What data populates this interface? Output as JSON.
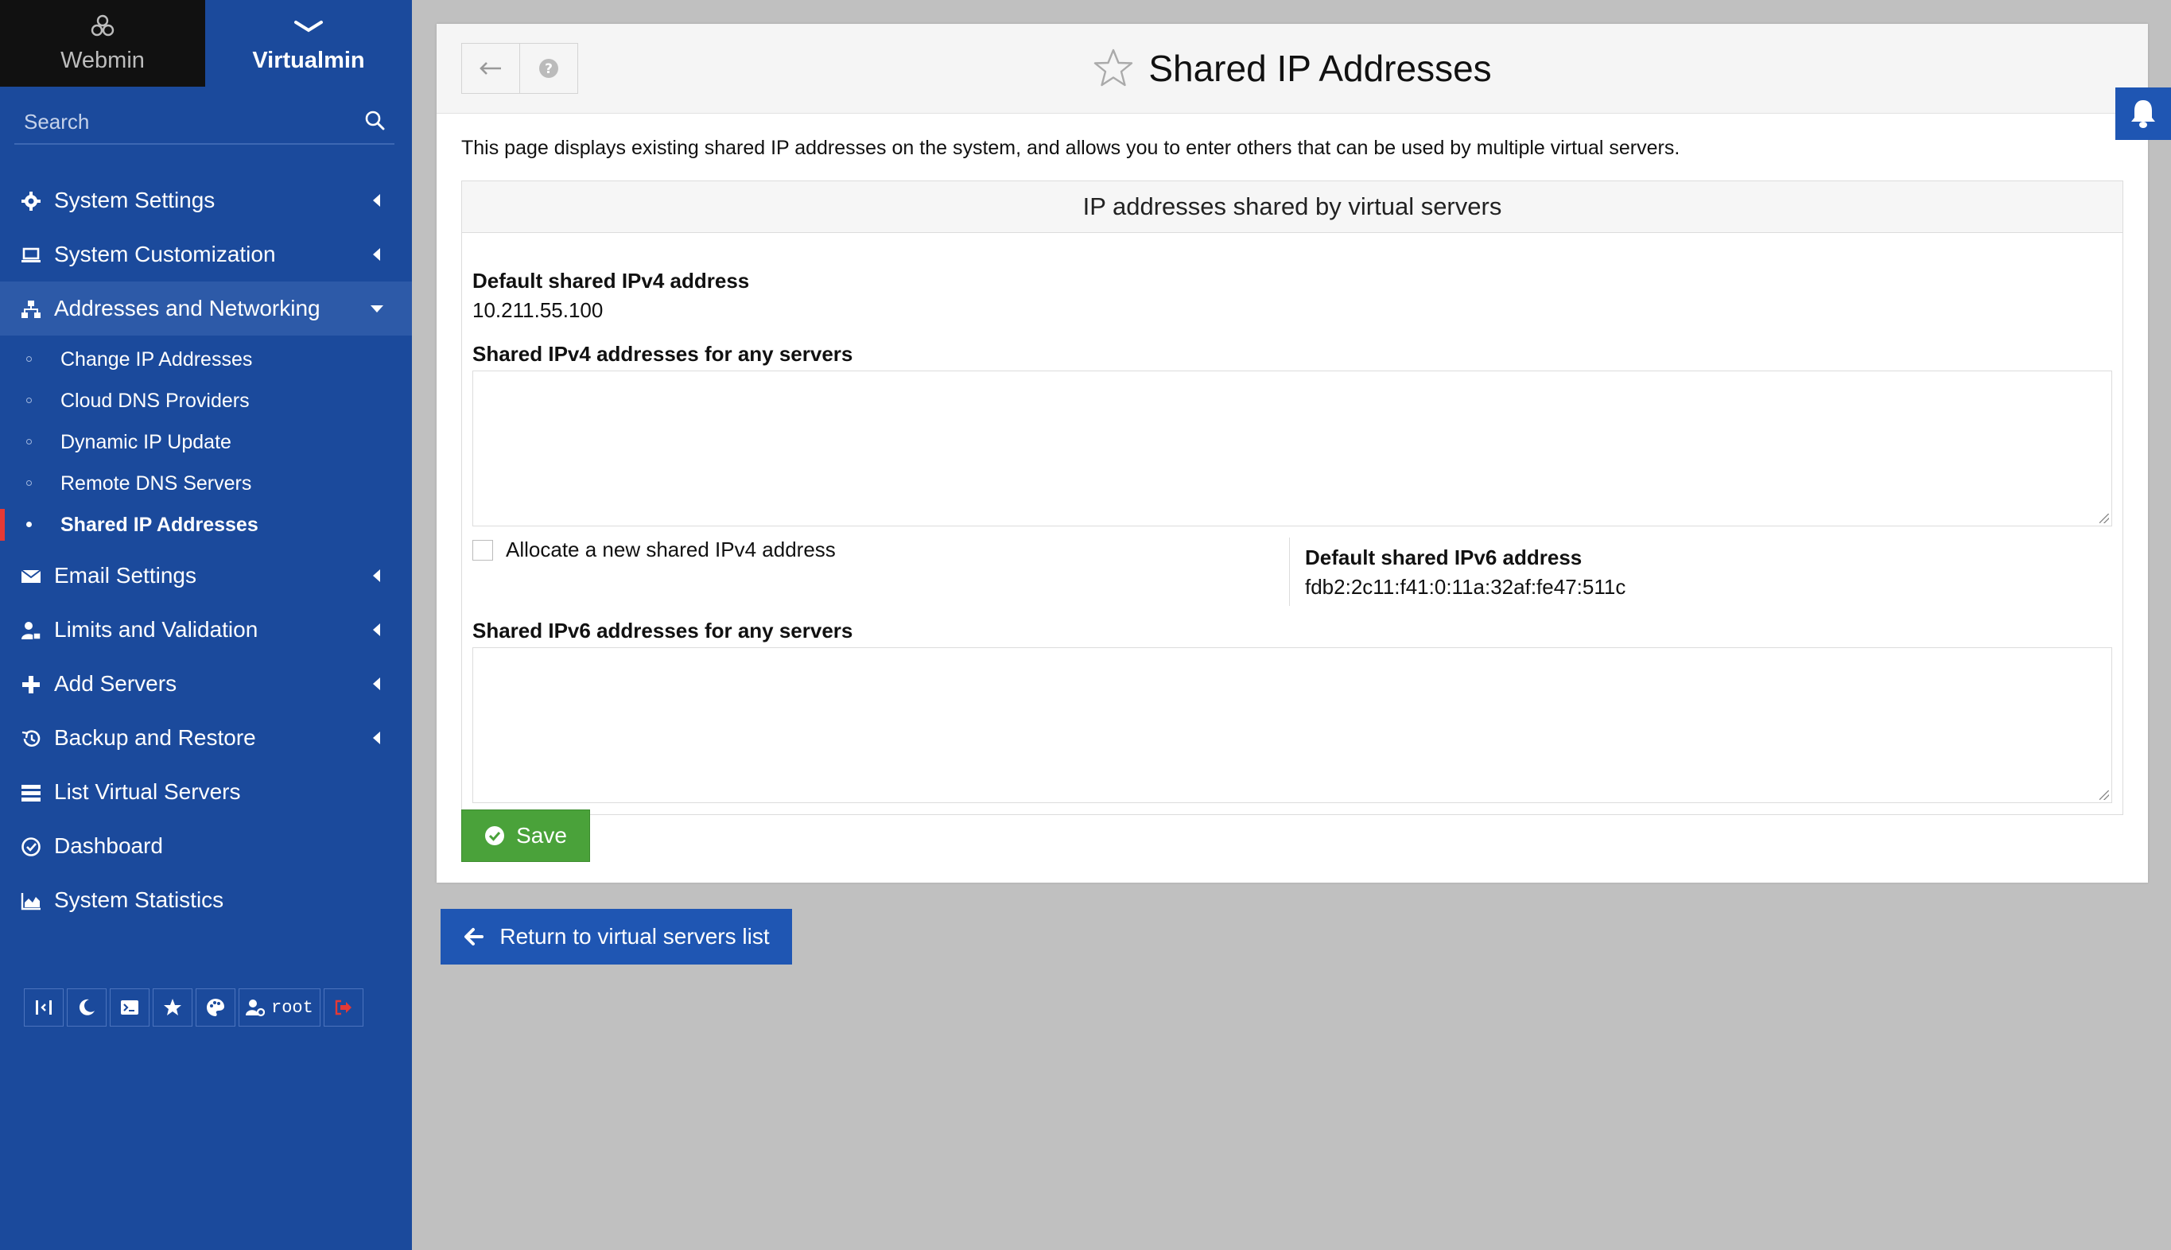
{
  "sidebar": {
    "tabs": [
      {
        "label": "Webmin",
        "icon": "webmin-logo-icon"
      },
      {
        "label": "Virtualmin",
        "icon": "chevron-down-icon"
      }
    ],
    "search": {
      "placeholder": "Search"
    },
    "menu": [
      {
        "label": "System Settings",
        "icon": "gear-icon"
      },
      {
        "label": "System Customization",
        "icon": "laptop-icon"
      },
      {
        "label": "Addresses and Networking",
        "icon": "network-icon",
        "expanded": true,
        "children": [
          {
            "label": "Change IP Addresses"
          },
          {
            "label": "Cloud DNS Providers"
          },
          {
            "label": "Dynamic IP Update"
          },
          {
            "label": "Remote DNS Servers"
          },
          {
            "label": "Shared IP Addresses",
            "active": true
          }
        ]
      },
      {
        "label": "Email Settings",
        "icon": "envelope-icon"
      },
      {
        "label": "Limits and Validation",
        "icon": "user-lock-icon"
      },
      {
        "label": "Add Servers",
        "icon": "plus-icon"
      },
      {
        "label": "Backup and Restore",
        "icon": "history-icon"
      },
      {
        "label": "List Virtual Servers",
        "icon": "server-list-icon"
      },
      {
        "label": "Dashboard",
        "icon": "dashboard-icon"
      },
      {
        "label": "System Statistics",
        "icon": "area-chart-icon"
      }
    ],
    "toolbar": {
      "user_label": "root",
      "icons": [
        "collapse-icon",
        "moon-icon",
        "terminal-icon",
        "star-icon",
        "palette-icon",
        "user-cog-icon",
        "logout-icon"
      ]
    }
  },
  "header": {
    "title": "Shared IP Addresses",
    "icons": [
      "back-arrow-icon",
      "help-icon",
      "star-outline-icon"
    ]
  },
  "main": {
    "description": "This page displays existing shared IP addresses on the system, and allows you to enter others that can be used by multiple virtual servers.",
    "section_title": "IP addresses shared by virtual servers",
    "default_ipv4_label": "Default shared IPv4 address",
    "default_ipv4_value": "10.211.55.100",
    "shared_ipv4_label": "Shared IPv4 addresses for any servers",
    "shared_ipv4_value": "",
    "allocate_label": "Allocate a new shared IPv4 address",
    "allocate_checked": false,
    "default_ipv6_label": "Default shared IPv6 address",
    "default_ipv6_value": "fdb2:2c11:f41:0:11a:32af:fe47:511c",
    "shared_ipv6_label": "Shared IPv6 addresses for any servers",
    "shared_ipv6_value": "",
    "save_label": "Save",
    "return_label": "Return to virtual servers list"
  },
  "colors": {
    "sidebar_bg": "#1b4a9c",
    "webmin_tab_bg": "#111111",
    "active_marker": "#e53935",
    "save_green": "#4aa23a",
    "return_blue": "#1f56b3",
    "page_bg": "#c0c0c0"
  }
}
